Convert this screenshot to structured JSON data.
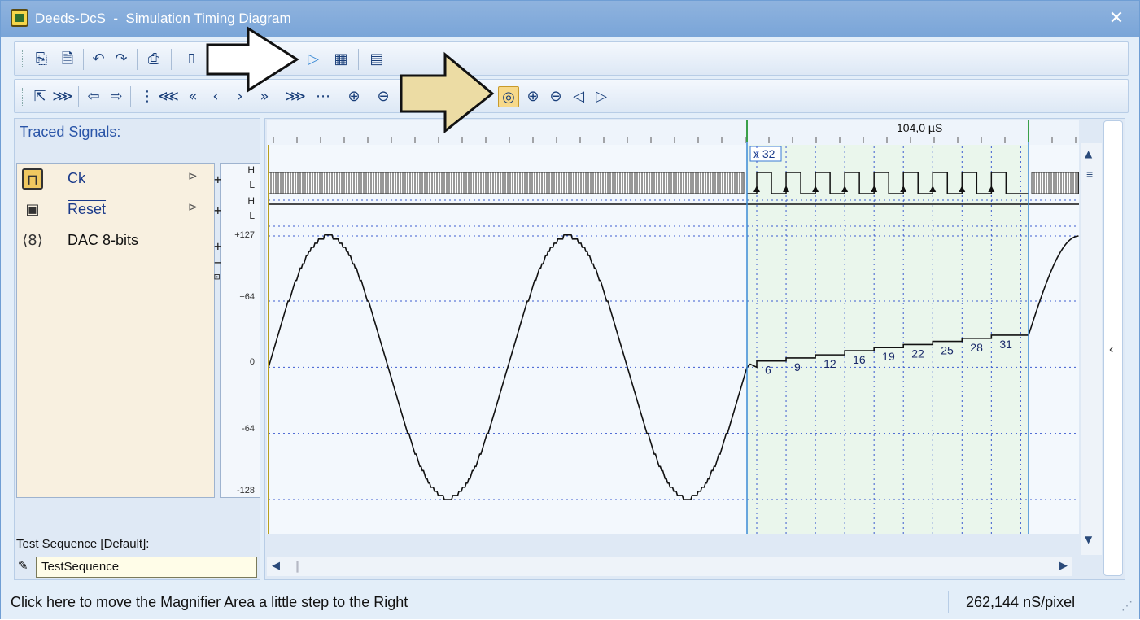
{
  "window": {
    "app_name": "Deeds-DcS",
    "separator": "-",
    "title": "Simulation Timing Diagram",
    "close": "✕"
  },
  "toolbar1": {
    "buttons": [
      "⎘",
      "🗎",
      "↶",
      "↷",
      "⎙",
      "⎍",
      "▷",
      "▦",
      "▤"
    ]
  },
  "toolbar2": {
    "buttons": [
      "⇱",
      "⋙",
      "⇦",
      "⇨",
      "⋮",
      "⋘",
      "«",
      "‹",
      "›",
      "»",
      "⋙",
      "⋯",
      "⊕",
      "⊖",
      "◎",
      "⊕",
      "⊖",
      "◁",
      "▷"
    ]
  },
  "left_panel": {
    "title": "Traced Signals:",
    "signals": [
      {
        "name": "Ck",
        "icon": "clock-icon",
        "h": "H",
        "l": "L"
      },
      {
        "name": "Reset",
        "icon": "reset-icon",
        "h": "H",
        "l": "L"
      },
      {
        "name": "DAC 8-bits",
        "icon": "bus-8-icon",
        "badge": "8"
      }
    ],
    "scale_ticks": [
      "+127",
      "+64",
      "0",
      "-64",
      "-128"
    ],
    "test_sequence_label": "Test Sequence [Default]:",
    "test_sequence_value": "TestSequence"
  },
  "plot": {
    "time_marker": "104,0 µS",
    "zoom_label": "x 32",
    "step_labels": [
      "6",
      "9",
      "12",
      "16",
      "19",
      "22",
      "25",
      "28",
      "31"
    ]
  },
  "chart_data": {
    "type": "line",
    "series": [
      {
        "name": "Ck",
        "kind": "clock"
      },
      {
        "name": "Reset",
        "kind": "digital",
        "values": [
          0
        ]
      },
      {
        "name": "DAC 8-bits",
        "kind": "analog-sine",
        "cycles_left": 2
      }
    ],
    "ylim": [
      -128,
      127
    ],
    "y_ticks": [
      127,
      64,
      0,
      -64,
      -128
    ],
    "magnified_values": [
      6,
      9,
      12,
      16,
      19,
      22,
      25,
      28,
      31
    ]
  },
  "status": {
    "hint": "Click here to move the Magnifier Area a little step to the Right",
    "scale": "262,144 nS/pixel"
  },
  "colors": {
    "title_bar": "#7aa5d8",
    "accent": "#3a7bd5",
    "magnifier_bg": "#eaf6ec",
    "annotation_white_arrow": "#ffffff",
    "annotation_beige_arrow": "#ecdca4"
  }
}
